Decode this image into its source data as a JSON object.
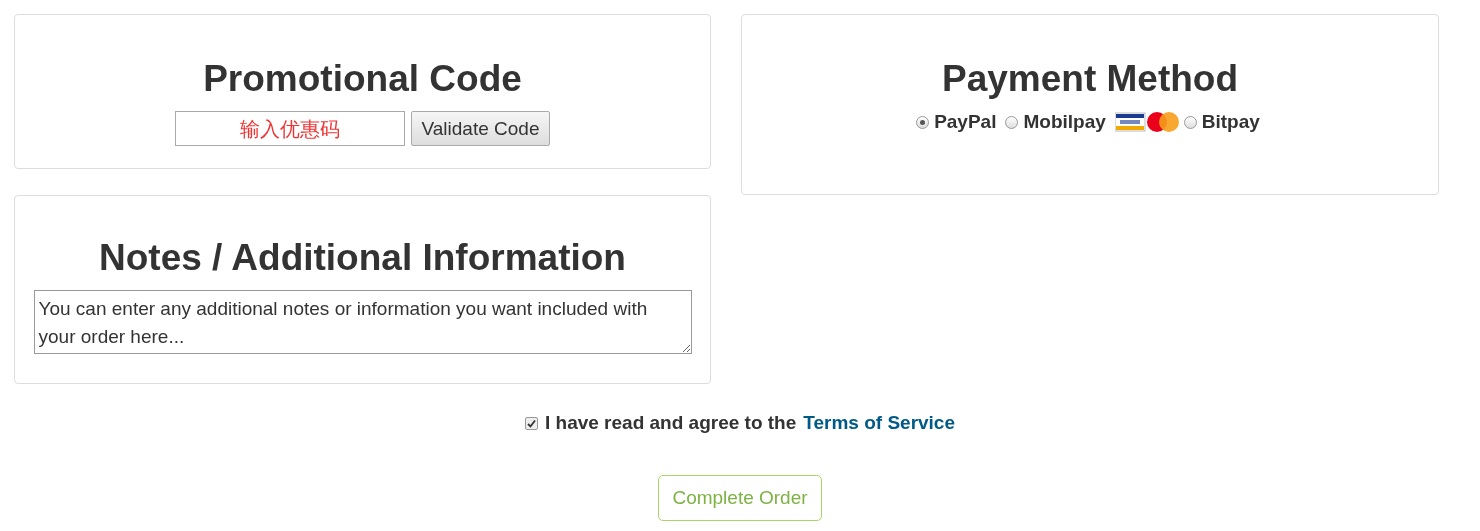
{
  "promo": {
    "title": "Promotional Code",
    "placeholder": "输入优惠码",
    "button": "Validate Code"
  },
  "payment": {
    "title": "Payment Method",
    "options": [
      {
        "label": "PayPal",
        "selected": true,
        "cards": false
      },
      {
        "label": "Mobilpay",
        "selected": false,
        "cards": true
      },
      {
        "label": "Bitpay",
        "selected": false,
        "cards": false
      }
    ]
  },
  "notes": {
    "title": "Notes / Additional Information",
    "value": "You can enter any additional notes or information you want included with your order here..."
  },
  "terms": {
    "checked": true,
    "text": "I have read and agree to the",
    "link": "Terms of Service"
  },
  "submit": "Complete Order"
}
